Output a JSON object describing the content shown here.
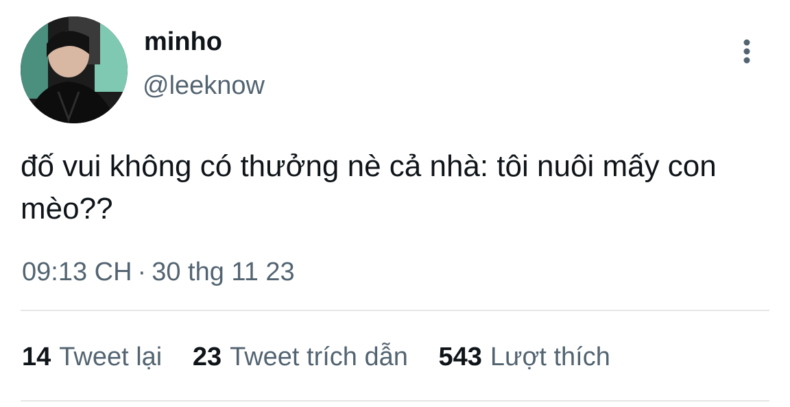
{
  "author": {
    "display_name": "minho",
    "handle": "@leeknow"
  },
  "tweet": {
    "text": "đố vui không có thưởng nè cả nhà: tôi nuôi mấy con mèo??",
    "time": "09:13 CH",
    "separator": "·",
    "date": "30 thg 11 23"
  },
  "stats": {
    "retweets": {
      "count": "14",
      "label": "Tweet lại"
    },
    "quotes": {
      "count": "23",
      "label": "Tweet trích dẫn"
    },
    "likes": {
      "count": "543",
      "label": "Lượt thích"
    }
  },
  "icons": {
    "more": "more-vertical-icon"
  },
  "colors": {
    "text_primary": "#0f1419",
    "text_secondary": "#536471",
    "divider": "#e6e6e6",
    "background": "#ffffff"
  }
}
